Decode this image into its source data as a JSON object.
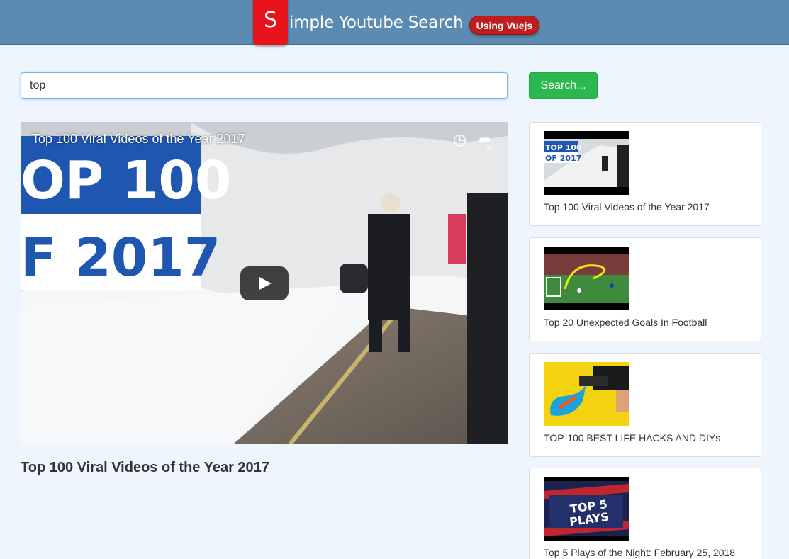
{
  "header": {
    "logo_letter": "S",
    "title": "imple Youtube Search",
    "badge": "Using Vuejs"
  },
  "search": {
    "value": "top",
    "button_label": "Search..."
  },
  "player": {
    "overlay_title": "Top 100 Viral Videos of the Year 2017",
    "thumb_text_line1": "OP 100",
    "thumb_text_line2": "F 2017",
    "watch_later_icon": "clock-icon",
    "share_icon": "share-arrow-icon",
    "share_count": "2"
  },
  "main": {
    "video_title": "Top 100 Viral Videos of the Year 2017"
  },
  "results": [
    {
      "title": "Top 100 Viral Videos of the Year 2017",
      "thumb_line1": "TOP 100",
      "thumb_line2": "OF 2017"
    },
    {
      "title": "Top 20 Unexpected Goals In Football"
    },
    {
      "title": "TOP-100 BEST LIFE HACKS AND DIYs"
    },
    {
      "title": "Top 5 Plays of the Night: February 25, 2018",
      "thumb_line1": "TOP 5",
      "thumb_line2": "PLAYS"
    }
  ],
  "colors": {
    "header_bg": "#5b8bb0",
    "logo_red": "#e8131b",
    "search_green": "#2bb84f",
    "page_bg": "#eef5fc"
  }
}
